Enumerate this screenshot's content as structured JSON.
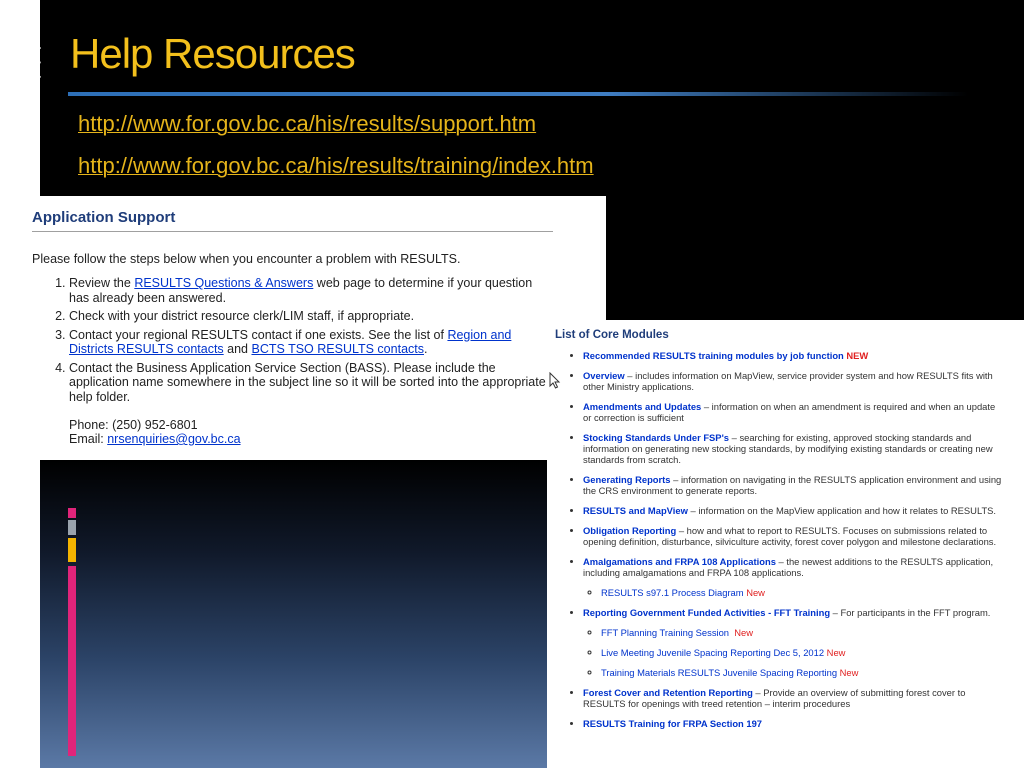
{
  "slide": {
    "title": "Help Resources",
    "links": [
      "http://www.for.gov.bc.ca/his/results/support.htm",
      "http://www.for.gov.bc.ca/his/results/training/index.htm"
    ],
    "colors": {
      "title": "#f3c01c",
      "link": "#e5b41a",
      "background": "#000000",
      "rule": "#2d6fb7"
    }
  },
  "support": {
    "heading": "Application Support",
    "intro": "Please follow the steps below when you encounter a problem with RESULTS.",
    "steps": {
      "s1_pre": "Review the ",
      "s1_link": "RESULTS Questions & Answers",
      "s1_post": " web page to determine if your question has already been answered.",
      "s2": "Check with your district resource clerk/LIM staff, if appropriate.",
      "s3_pre": "Contact your regional RESULTS contact if one exists. See the list of ",
      "s3_link1": "Region and Districts RESULTS contacts",
      "s3_mid": " and ",
      "s3_link2": "BCTS TSO RESULTS contacts",
      "s3_post": ".",
      "s4": "Contact the Business Application Service Section (BASS).  Please include the application name somewhere in the subject line so it will be sorted into the appropriate help folder."
    },
    "phone": "Phone: (250) 952-6801",
    "email_label": "Email: ",
    "email": "nrsenquiries@gov.bc.ca"
  },
  "modules": {
    "heading": "List of Core Modules",
    "new_label": "NEW",
    "new_label_sub": "New",
    "items": {
      "m1": "Recommended RESULTS training modules by job function",
      "m2_link": "Overview",
      "m2_desc": " – includes information on MapView, service provider system and how RESULTS fits with other Ministry applications.",
      "m3_link": "Amendments and Updates",
      "m3_desc": " – information on when an amendment is required and when an update or correction is sufficient",
      "m4_link": "Stocking Standards Under FSP's",
      "m4_desc": " – searching for existing, approved stocking standards and information on generating new stocking standards, by modifying existing standards or creating new standards from scratch.",
      "m5_link": "Generating Reports",
      "m5_desc": " – information on navigating in the RESULTS application environment and using the CRS environment to generate reports.",
      "m6_link": "RESULTS and MapView",
      "m6_desc": " – information on the MapView application and how it relates to RESULTS.",
      "m7_link": "Obligation Reporting",
      "m7_desc": " – how and what to report to RESULTS.  Focuses on submissions related to opening definition, disturbance, silviculture activity, forest cover polygon and milestone declarations.",
      "m8_link": "Amalgamations and FRPA 108 Applications",
      "m8_desc": " – the newest additions to the RESULTS application, including amalgamations and FRPA 108 applications.",
      "m8_sub1": "RESULTS s97.1 Process Diagram",
      "m9_link": "Reporting Government Funded Activities - FFT Training",
      "m9_desc": " – For participants in the FFT program.",
      "m9_sub1": "FFT Planning Training Session",
      "m9_sub2": "Live Meeting Juvenile Spacing Reporting Dec 5, 2012",
      "m9_sub3": "Training Materials RESULTS Juvenile Spacing Reporting",
      "m10_link": "Forest Cover and Retention Reporting",
      "m10_desc": " – Provide an overview of submitting forest cover to RESULTS for openings with treed retention – interim procedures",
      "m11_link": "RESULTS Training for FRPA Section 197"
    }
  }
}
